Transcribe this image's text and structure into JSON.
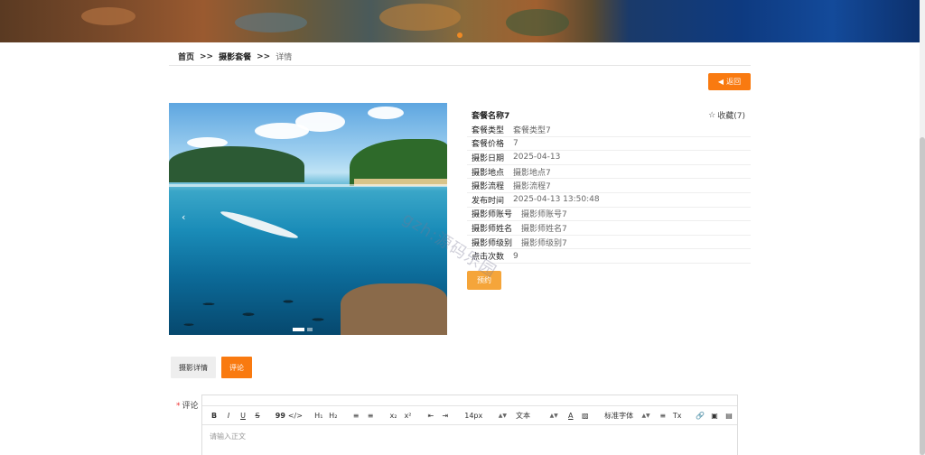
{
  "breadcrumb": {
    "home": "首页",
    "sep1": ">>",
    "section": "摄影套餐",
    "sep2": ">>",
    "current": "详情"
  },
  "back_button": {
    "label": "返回",
    "icon": "chevron-left-icon"
  },
  "detail": {
    "name": "套餐名称7",
    "favorite": {
      "label": "收藏(7)",
      "icon": "star-outline-icon"
    },
    "fields": [
      {
        "label": "套餐类型",
        "value": "套餐类型7"
      },
      {
        "label": "套餐价格",
        "value": "7"
      },
      {
        "label": "摄影日期",
        "value": "2025-04-13"
      },
      {
        "label": "摄影地点",
        "value": "摄影地点7"
      },
      {
        "label": "摄影流程",
        "value": "摄影流程7"
      },
      {
        "label": "发布时间",
        "value": "2025-04-13 13:50:48"
      },
      {
        "label": "摄影师账号",
        "value": "摄影师账号7"
      },
      {
        "label": "摄影师姓名",
        "value": "摄影师姓名7"
      },
      {
        "label": "摄影师级别",
        "value": "摄影师级别7"
      },
      {
        "label": "点击次数",
        "value": "9"
      }
    ],
    "book_button": "预约"
  },
  "carousel": {
    "prev_icon": "chevron-left-icon"
  },
  "watermark": "gzh:源码乐园",
  "tabs": [
    {
      "label": "摄影详情",
      "active": false
    },
    {
      "label": "评论",
      "active": true
    }
  ],
  "comment": {
    "required_mark": "*",
    "label": "评论",
    "placeholder": "请输入正文",
    "toolbar": {
      "bold": "B",
      "italic": "I",
      "underline": "U",
      "strike": "S",
      "quote": "99",
      "code": "</>",
      "h1": "H₁",
      "h2": "H₂",
      "ordered_list": "≡",
      "bullet_list": "≡",
      "subscript": "x₂",
      "superscript": "x²",
      "outdent": "⇤",
      "indent": "⇥",
      "size": "14px",
      "text_style": "文本",
      "color": "A",
      "background": "▨",
      "font": "标准字体",
      "align": "≡",
      "clean": "Tx",
      "link": "🔗",
      "image": "▣",
      "video": "▤"
    }
  },
  "colors": {
    "accent": "#f97a10",
    "book": "#f5a53a"
  }
}
